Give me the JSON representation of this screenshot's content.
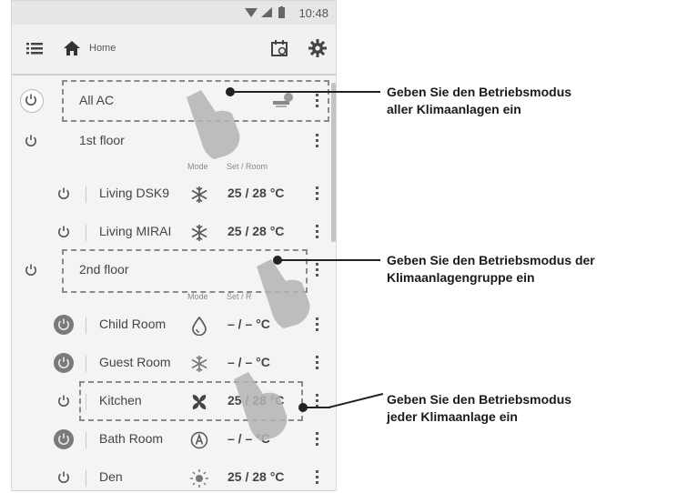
{
  "status_bar": {
    "time": "10:48"
  },
  "app_bar": {
    "title": "Home",
    "icons": [
      "menu-icon",
      "home-icon",
      "schedule-icon",
      "gear-icon"
    ]
  },
  "rows": {
    "all_ac": {
      "name": "All AC"
    },
    "first_floor": {
      "name": "1st floor"
    },
    "first_floor_headers": {
      "mode": "Mode",
      "set_room": "Set / Room"
    },
    "living_dsk9": {
      "name": "Living DSK9",
      "mode_icon": "snowflake-icon",
      "temp": "25 / 28 °C"
    },
    "living_mirai": {
      "name": "Living MIRAI",
      "mode_icon": "snowflake-icon",
      "temp": "25 / 28 °C"
    },
    "second_floor": {
      "name": "2nd floor"
    },
    "second_floor_headers": {
      "mode": "Mode",
      "set_room": "Set / R"
    },
    "child_room": {
      "name": "Child Room",
      "mode_icon": "droplet-icon",
      "temp": "– / –   °C"
    },
    "guest_room": {
      "name": "Guest Room",
      "mode_icon": "snowflake-icon",
      "temp": "– / –   °C"
    },
    "kitchen": {
      "name": "Kitchen",
      "mode_icon": "fan-icon",
      "temp": "25 / 28 °C"
    },
    "bath_room": {
      "name": "Bath Room",
      "mode_icon": "auto-icon",
      "temp": "– / –   °C"
    },
    "den": {
      "name": "Den",
      "mode_icon": "sun-icon",
      "temp": "25 / 28 °C"
    }
  },
  "callouts": {
    "all": [
      "Geben Sie den Betriebsmodus",
      "aller Klimaanlagen ein"
    ],
    "group": [
      "Geben Sie den Betriebsmodus der",
      "Klimaanlagengruppe ein"
    ],
    "each": [
      "Geben Sie den Betriebsmodus",
      "jeder Klimaanlage ein"
    ]
  },
  "colors": {
    "background": "#f4f4f4",
    "text": "#444444",
    "power_on": "#7a7a7a",
    "dash": "#8a8a8a"
  }
}
